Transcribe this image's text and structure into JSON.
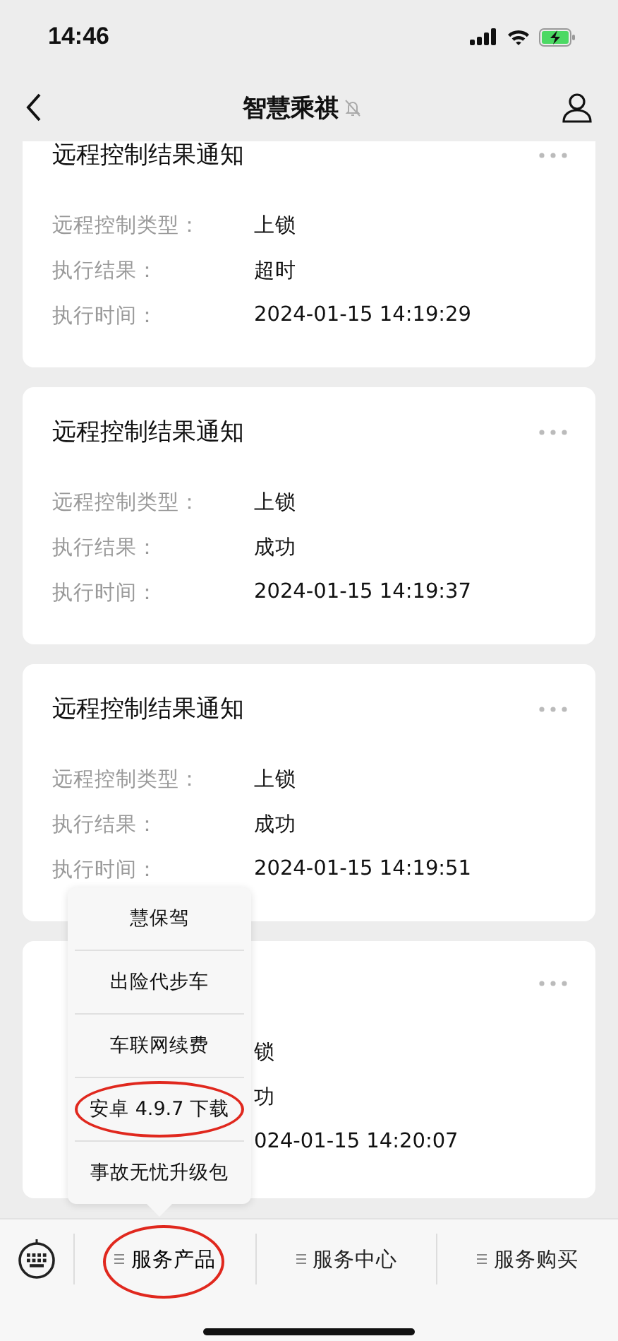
{
  "status_bar": {
    "time": "14:46"
  },
  "nav": {
    "title": "智慧乘祺",
    "muted": true
  },
  "cards": [
    {
      "title": "远程控制结果通知",
      "rows": [
        {
          "label": "远程控制类型：",
          "value": "上锁"
        },
        {
          "label": "执行结果：",
          "value": "超时"
        },
        {
          "label": "执行时间：",
          "value": "2024-01-15 14:19:29"
        }
      ]
    },
    {
      "title": "远程控制结果通知",
      "rows": [
        {
          "label": "远程控制类型：",
          "value": "上锁"
        },
        {
          "label": "执行结果：",
          "value": "成功"
        },
        {
          "label": "执行时间：",
          "value": "2024-01-15 14:19:37"
        }
      ]
    },
    {
      "title": "远程控制结果通知",
      "rows": [
        {
          "label": "远程控制类型：",
          "value": "上锁"
        },
        {
          "label": "执行结果：",
          "value": "成功"
        },
        {
          "label": "执行时间：",
          "value": "2024-01-15 14:19:51"
        }
      ]
    },
    {
      "rows": [
        {
          "value": "锁"
        },
        {
          "value": "功"
        },
        {
          "value": "024-01-15 14:20:07"
        }
      ]
    }
  ],
  "popup_menu": {
    "items": [
      {
        "label": "慧保驾",
        "circled": false
      },
      {
        "label": "出险代步车",
        "circled": false
      },
      {
        "label": "车联网续费",
        "circled": false
      },
      {
        "label": "安卓 4.9.7 下载",
        "circled": true
      },
      {
        "label": "事故无忧升级包",
        "circled": false
      }
    ]
  },
  "bottom_menu": [
    {
      "label": "服务产品",
      "selected": true,
      "circled": true
    },
    {
      "label": "服务中心",
      "selected": false,
      "circled": false
    },
    {
      "label": "服务购买",
      "selected": false,
      "circled": false
    }
  ]
}
